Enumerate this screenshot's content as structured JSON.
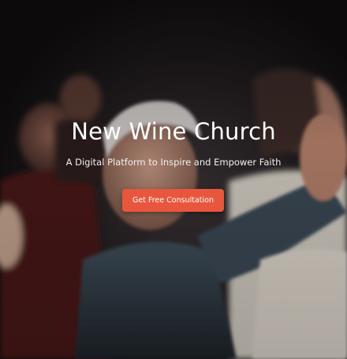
{
  "hero": {
    "title": "New Wine Church",
    "subtitle": "A Digital Platform to Inspire and Empower Faith",
    "cta_label": "Get Free Consultation",
    "background_image": "worship-crowd-photo"
  },
  "colors": {
    "accent": "#e8573d",
    "text": "#ffffff",
    "background": "#0d0b0c"
  }
}
